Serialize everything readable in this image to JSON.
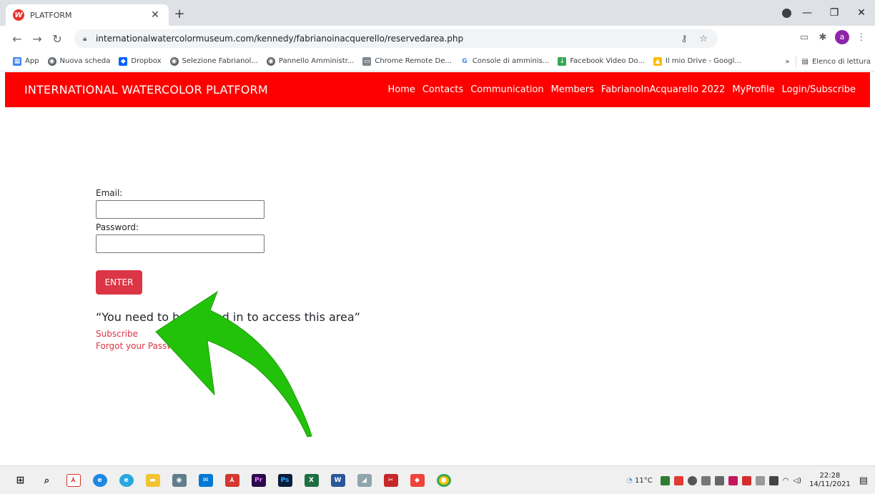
{
  "browser": {
    "tab_title": "PLATFORM",
    "tab_favicon": "W",
    "url": "internationalwatercolormuseum.com/kennedy/fabrianoinacquerello/reservedarea.php",
    "profile_initial": "a"
  },
  "bookmarks": [
    {
      "label": "App",
      "color": "#4285f4",
      "icon": "apps-grid-icon"
    },
    {
      "label": "Nuova scheda",
      "color": "#5f6368",
      "icon": "globe-icon"
    },
    {
      "label": "Dropbox",
      "color": "#0061ff",
      "icon": "dropbox-icon"
    },
    {
      "label": "Selezione Fabrianol...",
      "color": "#5f6368",
      "icon": "globe-icon"
    },
    {
      "label": "Pannello Amministr...",
      "color": "#5f6368",
      "icon": "globe-icon"
    },
    {
      "label": "Chrome Remote De...",
      "color": "#80868b",
      "icon": "remote-desktop-icon"
    },
    {
      "label": "Console di amminis...",
      "color": "#4285f4",
      "icon": "google-icon"
    },
    {
      "label": "Facebook Video Do...",
      "color": "#34a853",
      "icon": "download-icon"
    },
    {
      "label": "Il mio Drive - Googl...",
      "color": "#fbbc04",
      "icon": "drive-icon"
    }
  ],
  "bookmarks_more": "»",
  "reading_list": "Elenco di lettura",
  "site": {
    "brand": "INTERNATIONAL WATERCOLOR PLATFORM",
    "nav": [
      "Home",
      "Contacts",
      "Communication",
      "Members",
      "FabrianoInAcquarello 2022",
      "MyProfile",
      "Login/Subscribe"
    ]
  },
  "form": {
    "email_label": "Email:",
    "email_value": "",
    "password_label": "Password:",
    "password_value": "",
    "enter_label": "ENTER",
    "notice": "“You need to be logged in to access this area”",
    "subscribe": "Subscribe",
    "forgot": "Forgot your Password?"
  },
  "theme": {
    "navbar": "#ff0000",
    "button": "#dc3545",
    "arrow": "#22c20a"
  },
  "taskbar": {
    "weather": "11°C",
    "time": "22:28",
    "date": "14/11/2021"
  }
}
